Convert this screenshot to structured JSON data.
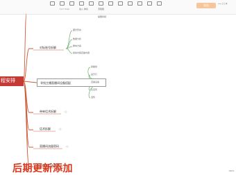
{
  "toolbar": {
    "items": [
      "",
      "",
      "",
      "",
      "",
      "",
      "",
      "",
      "",
      "",
      "",
      ""
    ],
    "label_top_a": "1.2 7.7mm",
    "label_top_b": "插入 弹窗",
    "label_top_c": "流程图",
    "label_top_d": "提醒条模",
    "export_button": "导出",
    "window_controls": "—  □  ×"
  },
  "mindmap": {
    "root": "程安排",
    "group1": {
      "title": "对标账号拆解",
      "children": [
        "图文形态",
        "数据分析",
        "脚本方案",
        "模拟内容直播内容"
      ]
    },
    "group2": {
      "title": "寻找主播直播间设备搭配",
      "children": [
        "铁路线",
        "蓝牙灯",
        "直播设备",
        "麦克风",
        "话筒"
      ]
    },
    "branches": [
      "带单话术拆解",
      "话术拆解",
      "直播间流量密码",
      "直播间引流复盘"
    ],
    "banner": "后期更新添加"
  },
  "status": {
    "zoom": "100%"
  }
}
